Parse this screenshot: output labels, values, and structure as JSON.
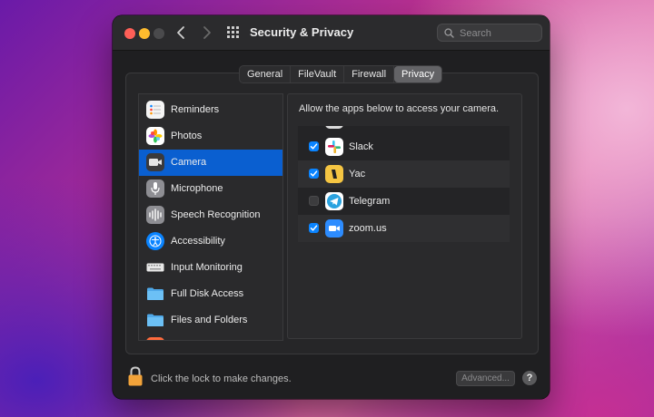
{
  "window": {
    "title": "Security & Privacy"
  },
  "search": {
    "placeholder": "Search"
  },
  "tabs": [
    {
      "label": "General",
      "selected": false
    },
    {
      "label": "FileVault",
      "selected": false
    },
    {
      "label": "Firewall",
      "selected": false
    },
    {
      "label": "Privacy",
      "selected": true
    }
  ],
  "sidebar": {
    "items": [
      {
        "label": "Reminders",
        "icon": "reminders-icon",
        "selected": false
      },
      {
        "label": "Photos",
        "icon": "photos-icon",
        "selected": false
      },
      {
        "label": "Camera",
        "icon": "camera-icon",
        "selected": true
      },
      {
        "label": "Microphone",
        "icon": "microphone-icon",
        "selected": false
      },
      {
        "label": "Speech Recognition",
        "icon": "speech-recognition-icon",
        "selected": false
      },
      {
        "label": "Accessibility",
        "icon": "accessibility-icon",
        "selected": false
      },
      {
        "label": "Input Monitoring",
        "icon": "keyboard-icon",
        "selected": false
      },
      {
        "label": "Full Disk Access",
        "icon": "folder-icon",
        "selected": false
      },
      {
        "label": "Files and Folders",
        "icon": "folder-icon",
        "selected": false
      }
    ]
  },
  "content": {
    "description": "Allow the apps below to access your camera.",
    "apps": [
      {
        "label": "Slack",
        "checked": true,
        "icon": "slack-icon"
      },
      {
        "label": "Yac",
        "checked": true,
        "icon": "yac-icon"
      },
      {
        "label": "Telegram",
        "checked": false,
        "icon": "telegram-icon"
      },
      {
        "label": "zoom.us",
        "checked": true,
        "icon": "zoom-icon"
      }
    ]
  },
  "footer": {
    "lock_text": "Click the lock to make changes.",
    "advanced_label": "Advanced...",
    "help_label": "?"
  },
  "colors": {
    "accent": "#0a84ff",
    "selection": "#0a5fd0",
    "window_bg": "#1f1f21"
  }
}
